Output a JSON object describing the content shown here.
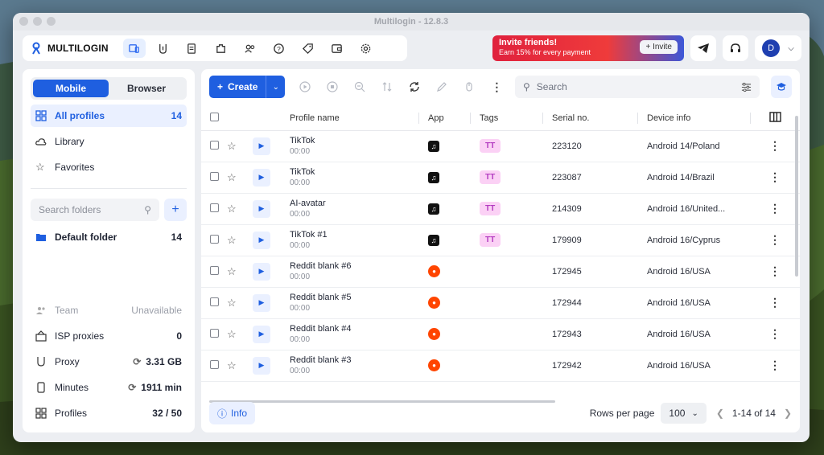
{
  "window": {
    "title": "Multilogin - 12.8.3"
  },
  "brand": {
    "name": "MULTILOGIN"
  },
  "nav": [
    "profiles-icon",
    "proxy-icon",
    "billing-icon",
    "extensions-icon",
    "team-icon",
    "help-icon",
    "tags-icon",
    "wallet-icon",
    "settings-icon"
  ],
  "invite": {
    "title": "Invite friends!",
    "subtitle": "Earn 15% for every payment",
    "button": "+ Invite"
  },
  "user": {
    "initial": "D"
  },
  "sidebar": {
    "tabs": {
      "mobile": "Mobile",
      "browser": "Browser"
    },
    "items": [
      {
        "label": "All profiles",
        "count": "14"
      },
      {
        "label": "Library",
        "count": ""
      },
      {
        "label": "Favorites",
        "count": ""
      }
    ],
    "search_placeholder": "Search folders",
    "folder": {
      "label": "Default folder",
      "count": "14"
    },
    "stats": {
      "team": {
        "label": "Team",
        "value": "Unavailable"
      },
      "isp": {
        "label": "ISP proxies",
        "value": "0"
      },
      "proxy": {
        "label": "Proxy",
        "value": "3.31 GB"
      },
      "minutes": {
        "label": "Minutes",
        "value": "1911 min"
      },
      "profiles": {
        "label": "Profiles",
        "value": "32 / 50"
      }
    }
  },
  "toolbar": {
    "create": "Create",
    "search_placeholder": "Search"
  },
  "table": {
    "headers": {
      "name": "Profile name",
      "app": "App",
      "tags": "Tags",
      "serial": "Serial no.",
      "device": "Device info"
    },
    "rows": [
      {
        "name": "TikTok",
        "time": "00:00",
        "app": "tiktok",
        "tag": "TT",
        "serial": "223120",
        "device": "Android 14/Poland"
      },
      {
        "name": "TikTok",
        "time": "00:00",
        "app": "tiktok",
        "tag": "TT",
        "serial": "223087",
        "device": "Android 14/Brazil"
      },
      {
        "name": "AI-avatar",
        "time": "00:00",
        "app": "tiktok",
        "tag": "TT",
        "serial": "214309",
        "device": "Android 16/United..."
      },
      {
        "name": "TikTok #1",
        "time": "00:00",
        "app": "tiktok",
        "tag": "TT",
        "serial": "179909",
        "device": "Android 16/Cyprus"
      },
      {
        "name": "Reddit blank #6",
        "time": "00:00",
        "app": "reddit",
        "tag": "",
        "serial": "172945",
        "device": "Android 16/USA"
      },
      {
        "name": "Reddit blank #5",
        "time": "00:00",
        "app": "reddit",
        "tag": "",
        "serial": "172944",
        "device": "Android 16/USA"
      },
      {
        "name": "Reddit blank #4",
        "time": "00:00",
        "app": "reddit",
        "tag": "",
        "serial": "172943",
        "device": "Android 16/USA"
      },
      {
        "name": "Reddit blank #3",
        "time": "00:00",
        "app": "reddit",
        "tag": "",
        "serial": "172942",
        "device": "Android 16/USA"
      }
    ]
  },
  "footer": {
    "info": "Info",
    "rows_label": "Rows per page",
    "rows_value": "100",
    "range": "1-14 of 14"
  }
}
